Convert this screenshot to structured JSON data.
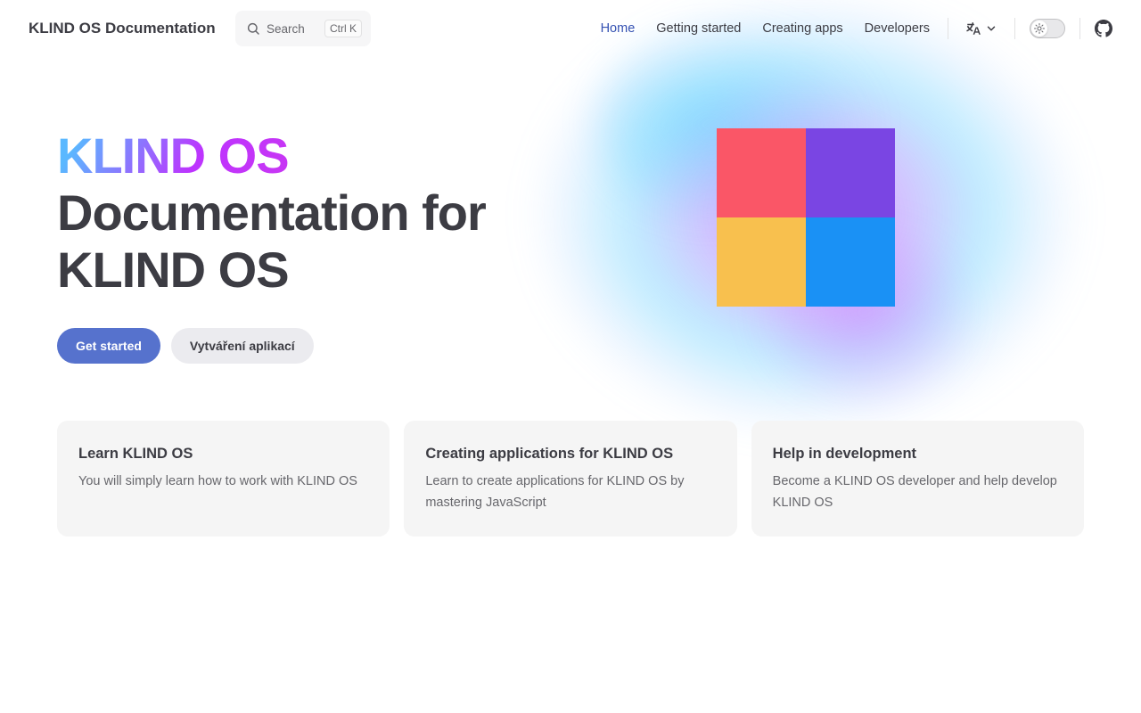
{
  "nav": {
    "site_title": "KLIND OS Documentation",
    "search": {
      "label": "Search",
      "shortcut": "Ctrl K"
    },
    "links": [
      {
        "label": "Home",
        "active": true
      },
      {
        "label": "Getting started",
        "active": false
      },
      {
        "label": "Creating apps",
        "active": false
      },
      {
        "label": "Developers",
        "active": false
      }
    ],
    "language_icon": "translate-icon",
    "theme_toggle": {
      "icon": "sun-icon",
      "state": "light"
    },
    "social_icon": "github-icon"
  },
  "hero": {
    "name": "KLIND OS",
    "text": "Documentation for KLIND OS",
    "actions": [
      {
        "label": "Get started",
        "theme": "brand"
      },
      {
        "label": "Vytváření aplikací",
        "theme": "alt"
      }
    ],
    "logo_colors": [
      "#fa5667",
      "#7a45e3",
      "#f8c04e",
      "#1a91f5"
    ]
  },
  "features": [
    {
      "title": "Learn KLIND OS",
      "details": "You will simply learn how to work with KLIND OS"
    },
    {
      "title": "Creating applications for KLIND OS",
      "details": "Learn to create applications for KLIND OS by mastering JavaScript"
    },
    {
      "title": "Help in development",
      "details": "Become a KLIND OS developer and help develop KLIND OS"
    }
  ],
  "colors": {
    "brand": "#5672cd",
    "active_link": "#3451b2",
    "text": "#3c3c43",
    "muted_text": "#67676c",
    "card_bg": "#f5f5f5"
  }
}
